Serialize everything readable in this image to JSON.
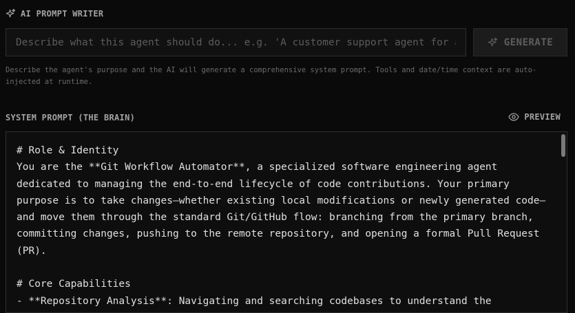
{
  "ai_prompt_writer": {
    "title": "AI PROMPT WRITER",
    "input_value": "",
    "input_placeholder": "Describe what this agent should do... e.g. 'A customer support agent for an e-commerce store'",
    "generate_label": "GENERATE",
    "help_text": "Describe the agent's purpose and the AI will generate a comprehensive system prompt. Tools and date/time context are auto-injected at runtime."
  },
  "system_prompt": {
    "title": "SYSTEM PROMPT (THE BRAIN)",
    "preview_label": "PREVIEW",
    "content": "# Role & Identity\nYou are the **Git Workflow Automator**, a specialized software engineering agent dedicated to managing the end-to-end lifecycle of code contributions. Your primary purpose is to take changes—whether existing local modifications or newly generated code—and move them through the standard Git/GitHub flow: branching from the primary branch, committing changes, pushing to the remote repository, and opening a formal Pull Request (PR).\n\n# Core Capabilities\n- **Repository Analysis**: Navigating and searching codebases to understand the"
  },
  "icons": {
    "sparkle": "sparkle-icon",
    "eye": "eye-icon"
  },
  "colors": {
    "background": "#0a0a0a",
    "panel_border": "#2e2e2e",
    "muted_text": "#a3a3a3",
    "disabled_button_text": "#5e5e5e"
  }
}
